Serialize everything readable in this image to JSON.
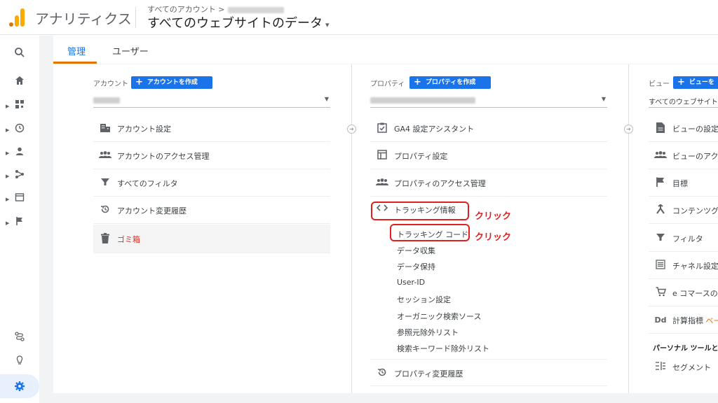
{
  "header": {
    "app_title": "アナリティクス",
    "breadcrumb": "すべてのアカウント >",
    "view_name": "すべてのウェブサイトのデータ",
    "caret": "▾"
  },
  "tabs": [
    {
      "label": "管理",
      "active": true
    },
    {
      "label": "ユーザー",
      "active": false
    }
  ],
  "account": {
    "label": "アカウント",
    "create_button": "アカウントを作成",
    "items": [
      {
        "icon": "building-icon",
        "label": "アカウント設定"
      },
      {
        "icon": "people-icon",
        "label": "アカウントのアクセス管理"
      },
      {
        "icon": "filter-icon",
        "label": "すべてのフィルタ"
      },
      {
        "icon": "history-icon",
        "label": "アカウント変更履歴"
      },
      {
        "icon": "trash-icon",
        "label": "ゴミ箱"
      }
    ]
  },
  "property": {
    "label": "プロパティ",
    "create_button": "プロパティを作成",
    "items": [
      {
        "icon": "checklist-icon",
        "label": "GA4 設定アシスタント"
      },
      {
        "icon": "layout-icon",
        "label": "プロパティ設定"
      },
      {
        "icon": "people-icon",
        "label": "プロパティのアクセス管理"
      },
      {
        "icon": "code-icon",
        "label": "トラッキング情報"
      }
    ],
    "tracking_sub": [
      "トラッキング コード",
      "データ収集",
      "データ保持",
      "User-ID",
      "セッション設定",
      "オーガニック検索ソース",
      "参照元除外リスト",
      "検索キーワード除外リスト"
    ],
    "history": "プロパティ変更履歴"
  },
  "view": {
    "label": "ビュー",
    "create_button": "ビューを",
    "selected": "すべてのウェブサイトの",
    "items": [
      {
        "icon": "document-icon",
        "label": "ビューの設定"
      },
      {
        "icon": "people-icon",
        "label": "ビューのアク"
      },
      {
        "icon": "flag-icon",
        "label": "目標"
      },
      {
        "icon": "grouping-icon",
        "label": "コンテンツグ"
      },
      {
        "icon": "filter-icon",
        "label": "フィルタ"
      },
      {
        "icon": "channel-icon",
        "label": "チャネル設定"
      },
      {
        "icon": "cart-icon",
        "label": "e コマースの"
      },
      {
        "icon": "dd-icon",
        "label": "計算指標"
      }
    ],
    "calc_beta": "ベー",
    "personal_tools_head": "パーソナル ツールとア",
    "segment": "セグメント"
  },
  "annotations": {
    "click1": "クリック",
    "click2": "クリック"
  },
  "colors": {
    "accent": "#1a73e8",
    "tab_underline": "#e37400",
    "highlight": "#e02020"
  }
}
